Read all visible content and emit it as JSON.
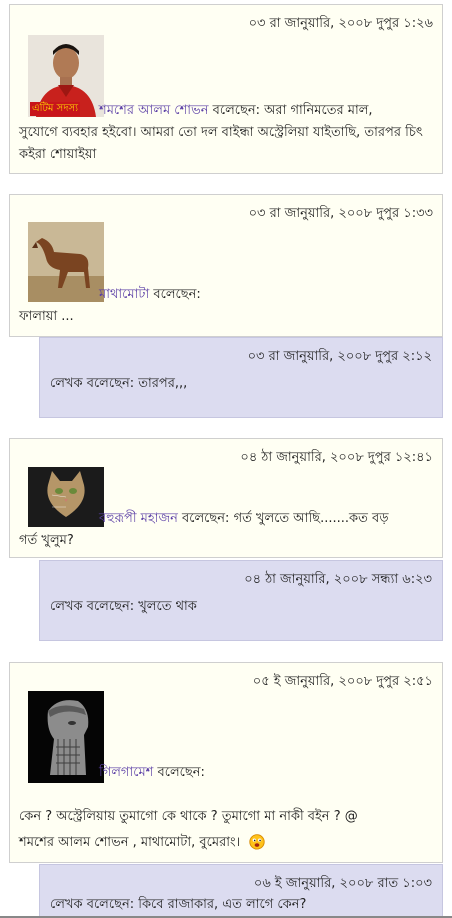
{
  "comments": [
    {
      "timestamp": "০৩ রা জানুয়ারি, ২০০৮ দুপুর ১:২৬",
      "avatar": "man-portrait",
      "badge": "এটিম সদস্য",
      "author": "শমশের আলম শোভন",
      "said": "বলেছেন:",
      "text_inline": "অরা গানিমতের মাল,",
      "text_rest": "সুযোগে ব্যবহার হইবো। আমরা তো দল বাইন্ধা অস্ট্রেলিয়া যাইতাছি, তারপর চিৎ কইরা শোয়াইয়া"
    },
    {
      "timestamp": "০৩ রা জানুয়ারি, ২০০৮ দুপুর ১:৩৩",
      "avatar": "horse",
      "author": "মাথামোটা",
      "said": "বলেছেন:",
      "text_rest": "ফালায়া ..."
    },
    {
      "timestamp": "০৪ ঠা জানুয়ারি, ২০০৮ দুপুর ১২:৪১",
      "avatar": "cat",
      "author": "বহুরূপী মহাজন",
      "said": "বলেছেন:",
      "text_inline": "গর্ত খুলতে আছি.......কত বড়",
      "text_rest": "গর্ত খুলুম?"
    },
    {
      "timestamp": "০৫ ই জানুয়ারি, ২০০৮ দুপুর ২:৫১",
      "avatar": "stone-statue",
      "author": "গিলগামেশ",
      "said": "বলেছেন:",
      "text_line1": "কেন ? অস্ট্রেলিয়ায় তুমাগো কে থাকে ? তুমাগো মা নাকী বইন ? @",
      "text_line2": "শমশের আলম শোভন , মাথামোটা, বুমেরাং।",
      "smiley": "smiley-icon"
    }
  ],
  "replies": [
    {
      "timestamp": "০৩ রা জানুয়ারি, ২০০৮ দুপুর ২:১২",
      "text": "লেখক বলেছেন: তারপর,,,"
    },
    {
      "timestamp": "০৪ ঠা জানুয়ারি, ২০০৮ সন্ধ্যা ৬:২৩",
      "text": "লেখক বলেছেন: খুলতে থাক"
    },
    {
      "timestamp": "০৬ ই জানুয়ারি, ২০০৮ রাত ১:০৩",
      "text": "লেখক বলেছেন: কিবে রাজাকার, এত লাগে কেন?"
    }
  ]
}
